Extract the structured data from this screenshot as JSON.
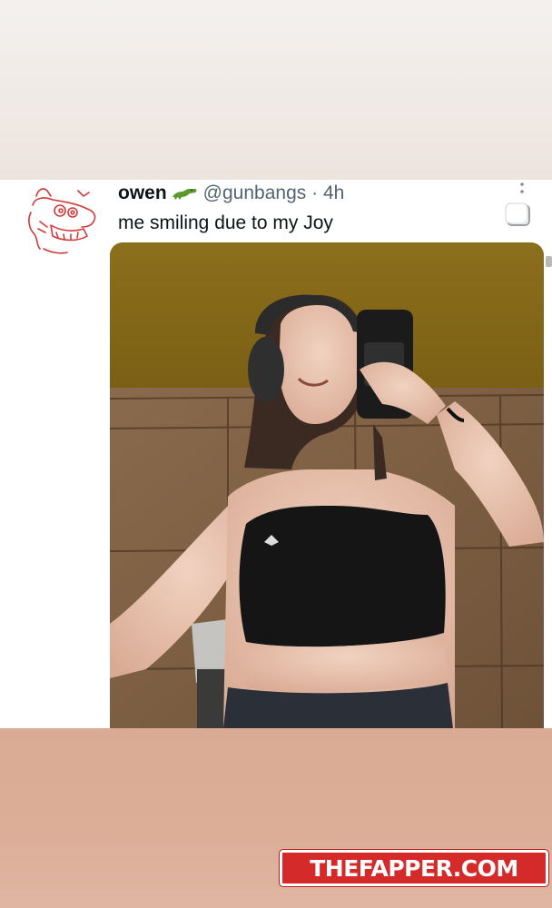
{
  "tweet": {
    "display_name": "owen",
    "handle": "@gunbangs",
    "separator": "·",
    "time": "4h",
    "text": "me smiling due to my Joy",
    "emoji_icon": "crocodile-emoji-icon",
    "image_subject": "photo-mirror-selfie"
  },
  "watermark": {
    "text": "THEFAPPER.COM",
    "color": "#d42a2a"
  },
  "colors": {
    "top_band": "#efe6e1",
    "bottom_band": "#d9ab94",
    "text_primary": "#0f1419",
    "text_secondary": "#536471"
  }
}
